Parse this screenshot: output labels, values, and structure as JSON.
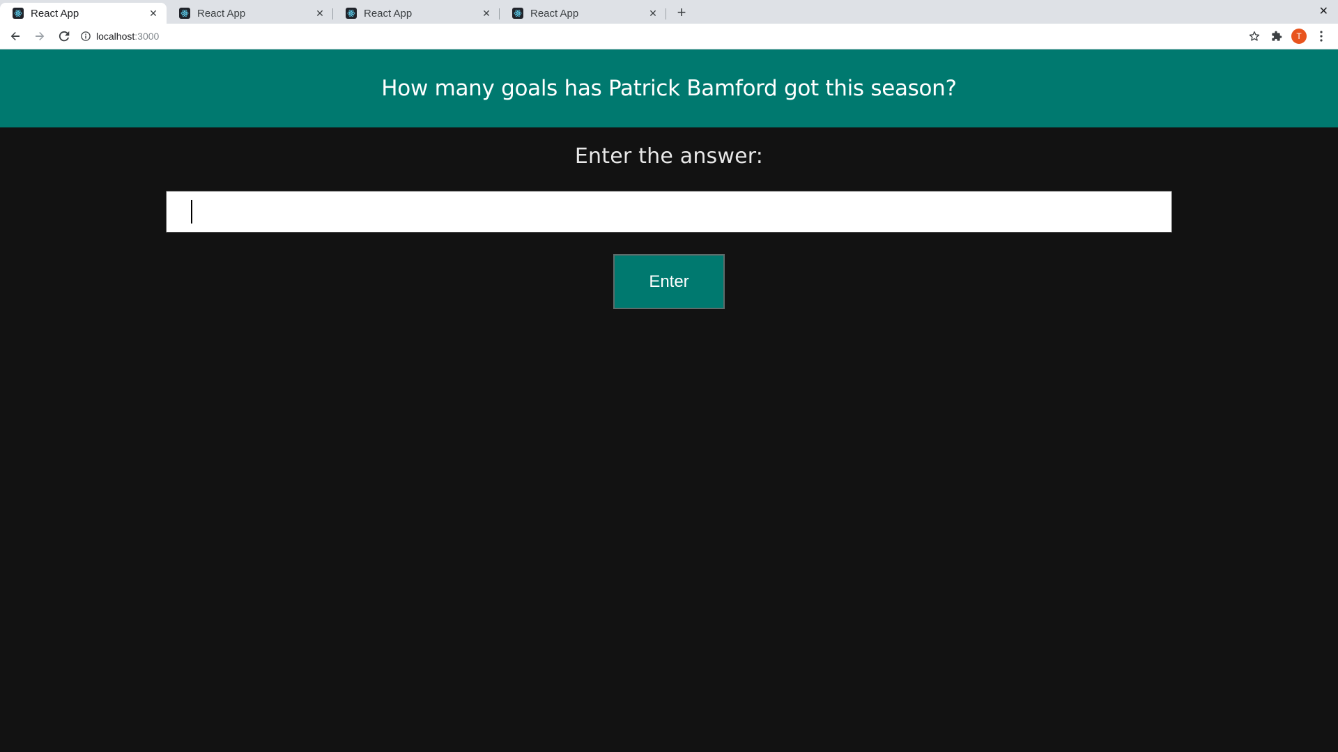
{
  "browser": {
    "tabs": [
      {
        "title": "React App",
        "active": true
      },
      {
        "title": "React App",
        "active": false
      },
      {
        "title": "React App",
        "active": false
      },
      {
        "title": "React App",
        "active": false
      }
    ],
    "new_tab_label": "+",
    "window_close_label": "✕",
    "url_host": "localhost",
    "url_port": ":3000",
    "profile_initial": "T"
  },
  "quiz": {
    "question": "How many goals has Patrick Bamford got this season?",
    "prompt": "Enter the answer:",
    "answer_value": "",
    "submit_label": "Enter"
  },
  "colors": {
    "banner": "#00796f",
    "background": "#121212",
    "button": "#00796f",
    "profile": "#e8541e"
  }
}
